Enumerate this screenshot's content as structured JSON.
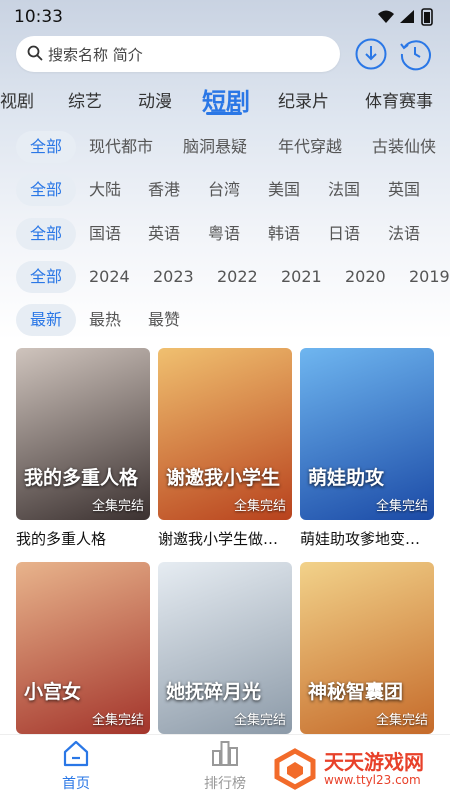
{
  "status_bar": {
    "time": "10:33"
  },
  "search": {
    "placeholder": "搜索名称 简介"
  },
  "tabs": [
    {
      "label": "视剧"
    },
    {
      "label": "综艺"
    },
    {
      "label": "动漫"
    },
    {
      "label": "短剧",
      "active": true
    },
    {
      "label": "纪录片"
    },
    {
      "label": "体育赛事"
    }
  ],
  "filters": [
    {
      "items": [
        "全部",
        "现代都市",
        "脑洞悬疑",
        "年代穿越",
        "古装仙侠"
      ]
    },
    {
      "items": [
        "全部",
        "大陆",
        "香港",
        "台湾",
        "美国",
        "法国",
        "英国"
      ]
    },
    {
      "items": [
        "全部",
        "国语",
        "英语",
        "粤语",
        "韩语",
        "日语",
        "法语"
      ]
    },
    {
      "items": [
        "全部",
        "2024",
        "2023",
        "2022",
        "2021",
        "2020",
        "2019"
      ]
    },
    {
      "items": [
        "最新",
        "最热",
        "最赞"
      ]
    }
  ],
  "cards": [
    {
      "title": "我的多重人格",
      "poster_text": "我的多重人格",
      "badge": "全集完结",
      "color1": "#3b3130",
      "color2": "#cfc4bd"
    },
    {
      "title": "谢邀我小学生做…",
      "poster_text": "谢邀我小学生",
      "badge": "全集完结",
      "color1": "#b8421d",
      "color2": "#f0c070"
    },
    {
      "title": "萌娃助攻爹地变…",
      "poster_text": "萌娃助攻",
      "badge": "全集完结",
      "color1": "#1b4aa6",
      "color2": "#6fb6f0"
    },
    {
      "title": "",
      "poster_text": "小宫女",
      "badge": "全集完结",
      "color1": "#a3342b",
      "color2": "#e8b48c"
    },
    {
      "title": "",
      "poster_text": "她抚碎月光",
      "badge": "全集完结",
      "color1": "#8c9aa8",
      "color2": "#e6ecf2"
    },
    {
      "title": "",
      "poster_text": "神秘智囊团",
      "badge": "全集完结",
      "color1": "#c56a2a",
      "color2": "#f2d28a"
    }
  ],
  "bottom_nav": [
    {
      "label": "首页",
      "active": true
    },
    {
      "label": "排行榜"
    }
  ],
  "watermark": {
    "title": "天天游戏网",
    "url": "www.ttyl23.com"
  },
  "colors": {
    "accent": "#2a77e6",
    "chip_bg": "#e7edf4"
  }
}
